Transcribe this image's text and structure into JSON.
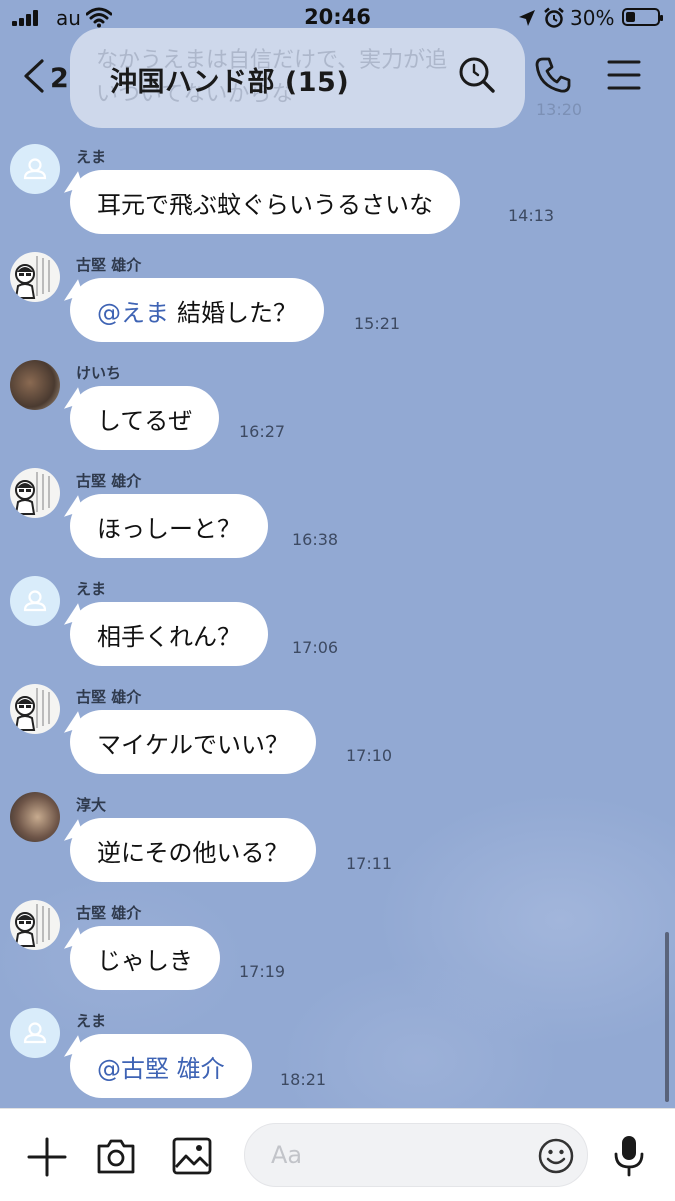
{
  "status": {
    "carrier": "au",
    "time": "20:46",
    "battery": "30%",
    "battery_level": 0.3
  },
  "header": {
    "back_count": "2",
    "title": "沖国ハンド部 (15)"
  },
  "partial_message": {
    "lines": [
      "なかうえまは自信だけで、実力が追",
      "いついてないからな"
    ],
    "time": "13:20"
  },
  "messages": [
    {
      "sender": "えま",
      "avatar": "default",
      "text": "耳元で飛ぶ蚊ぐらいうるさいな",
      "time": "14:13"
    },
    {
      "sender": "古堅 雄介",
      "avatar": "manga",
      "mention": "@えま",
      "text": "結婚した？",
      "time": "15:21"
    },
    {
      "sender": "けいち",
      "avatar": "cat",
      "text": "してるぜ",
      "time": "16:27"
    },
    {
      "sender": "古堅 雄介",
      "avatar": "manga",
      "text": "ほっしーと？",
      "time": "16:38"
    },
    {
      "sender": "えま",
      "avatar": "default",
      "text": "相手くれん？",
      "time": "17:06"
    },
    {
      "sender": "古堅 雄介",
      "avatar": "manga",
      "text": "マイケルでいい？",
      "time": "17:10"
    },
    {
      "sender": "淳大",
      "avatar": "photo",
      "text": "逆にその他いる？",
      "time": "17:11"
    },
    {
      "sender": "古堅 雄介",
      "avatar": "manga",
      "text": "じゃしき",
      "time": "17:19"
    },
    {
      "sender": "えま",
      "avatar": "default",
      "mention": "@古堅 雄介",
      "text": "",
      "time": "18:21"
    }
  ],
  "input": {
    "placeholder": "Aa",
    "value": ""
  },
  "icons": {
    "back": "chevron-left-icon",
    "search": "search-icon",
    "call": "phone-icon",
    "menu": "menu-icon",
    "plus": "plus-icon",
    "camera": "camera-icon",
    "image": "image-icon",
    "emoji": "emoji-icon",
    "mic": "mic-icon"
  },
  "colors": {
    "chat_background": "#92a9d3",
    "bubble": "#ffffff",
    "mention": "#3e63b4",
    "avatar_default": "#d9ecfa"
  }
}
